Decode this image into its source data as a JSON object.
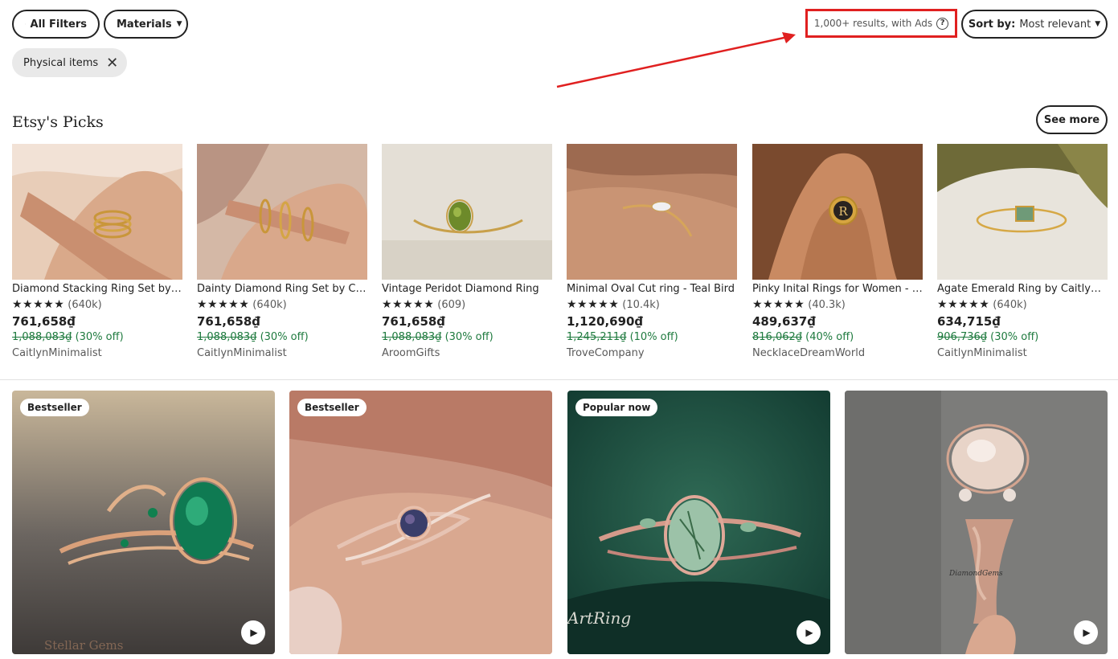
{
  "filters": {
    "all_filters_label": "All Filters",
    "materials_label": "Materials",
    "active_chip_label": "Physical items"
  },
  "results": {
    "count_text": "1,000+ results, with Ads",
    "help_glyph": "?"
  },
  "sort": {
    "label": "Sort by:",
    "value": "Most relevant"
  },
  "picks": {
    "heading": "Etsy's Picks",
    "see_more_label": "See more",
    "items": [
      {
        "title": "Diamond Stacking Ring Set by CaitlynMinimalist",
        "stars": "★★★★★",
        "reviews": "(640k)",
        "price": "761,658₫",
        "original": "1,088,083₫",
        "discount": "(30% off)",
        "shop": "CaitlynMinimalist"
      },
      {
        "title": "Dainty Diamond Ring Set by CaitlynMinimalist",
        "stars": "★★★★★",
        "reviews": "(640k)",
        "price": "761,658₫",
        "original": "1,088,083₫",
        "discount": "(30% off)",
        "shop": "CaitlynMinimalist"
      },
      {
        "title": "Vintage Peridot Diamond Ring",
        "stars": "★★★★★",
        "reviews": "(609)",
        "price": "761,658₫",
        "original": "1,088,083₫",
        "discount": "(30% off)",
        "shop": "AroomGifts"
      },
      {
        "title": "Minimal Oval Cut ring - Teal Bird",
        "stars": "★★★★★",
        "reviews": "(10.4k)",
        "price": "1,120,690₫",
        "original": "1,245,211₫",
        "discount": "(10% off)",
        "shop": "TroveCompany"
      },
      {
        "title": "Pinky Inital Rings for Women - Gold",
        "stars": "★★★★★",
        "reviews": "(40.3k)",
        "price": "489,637₫",
        "original": "816,062₫",
        "discount": "(40% off)",
        "shop": "NecklaceDreamWorld"
      },
      {
        "title": "Agate Emerald Ring by CaitlynMinimalist",
        "stars": "★★★★★",
        "reviews": "(640k)",
        "price": "634,715₫",
        "original": "906,736₫",
        "discount": "(30% off)",
        "shop": "CaitlynMinimalist"
      }
    ]
  },
  "listings": [
    {
      "badge": "Bestseller",
      "play_glyph": "▶",
      "watermark": "Stellar Gems"
    },
    {
      "badge": "Bestseller",
      "play_glyph": "▶"
    },
    {
      "badge": "Popular now",
      "play_glyph": "▶",
      "watermark": "ArtRing"
    },
    {
      "badge": "",
      "play_glyph": "▶",
      "watermark": "DiamondGems"
    }
  ],
  "colors": {
    "highlight_red": "#e02020",
    "discount_green": "#1e7a3e"
  }
}
